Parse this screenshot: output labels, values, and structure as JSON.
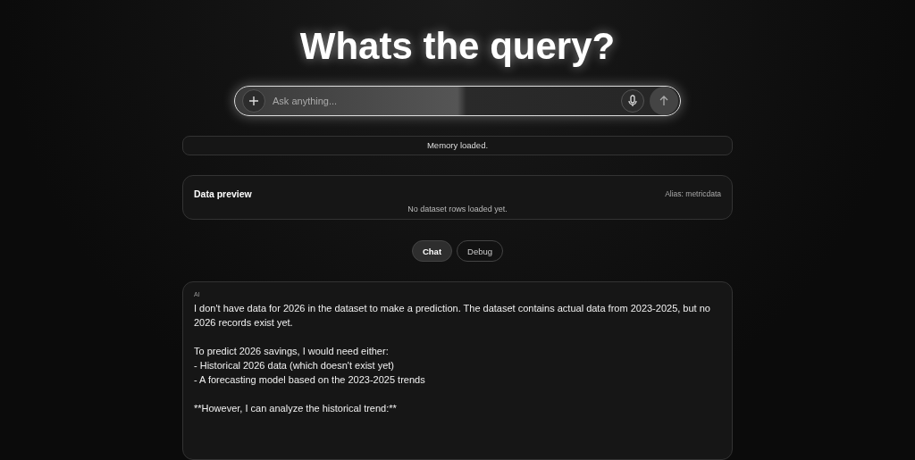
{
  "title": "Whats the query?",
  "search": {
    "placeholder": "Ask anything..."
  },
  "status": "Memory loaded.",
  "data_preview": {
    "title": "Data preview",
    "alias": "Alias: metricdata",
    "empty_message": "No dataset rows loaded yet."
  },
  "tabs": [
    {
      "label": "Chat",
      "selected": true
    },
    {
      "label": "Debug",
      "selected": false
    }
  ],
  "message": {
    "sender": "AI",
    "paragraphs": [
      [
        "I don't have data for 2026 in the dataset to make a prediction. The dataset contains actual data from 2023-2025, but no 2026 records exist yet."
      ],
      [
        "To predict 2026 savings, I would need either:",
        "- Historical 2026 data (which doesn't exist yet)",
        "- A forecasting model based on the 2023-2025 trends"
      ],
      [
        "**However, I can analyze the historical trend:**"
      ]
    ]
  }
}
